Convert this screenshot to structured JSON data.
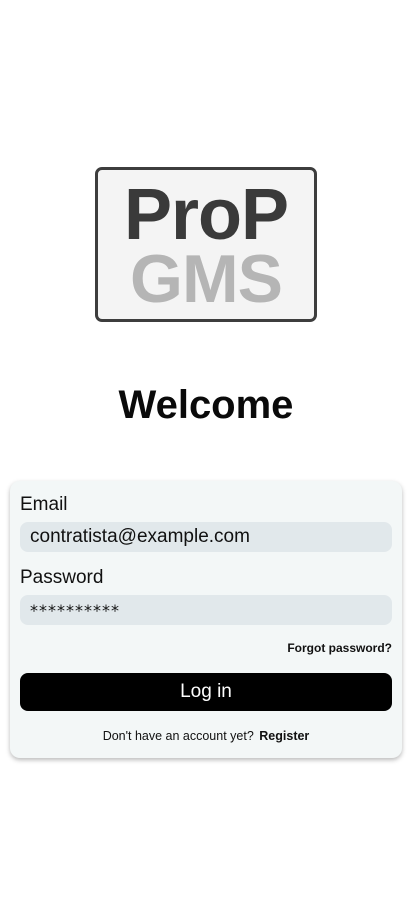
{
  "logo": {
    "line1": "ProP",
    "line2": "GMS"
  },
  "welcome": "Welcome",
  "form": {
    "email_label": "Email",
    "email_value": "contratista@example.com",
    "password_label": "Password",
    "password_value": "**********",
    "forgot_label": "Forgot password?",
    "login_label": "Log in",
    "register_prompt": "Don't have an account yet?",
    "register_label": "Register"
  }
}
